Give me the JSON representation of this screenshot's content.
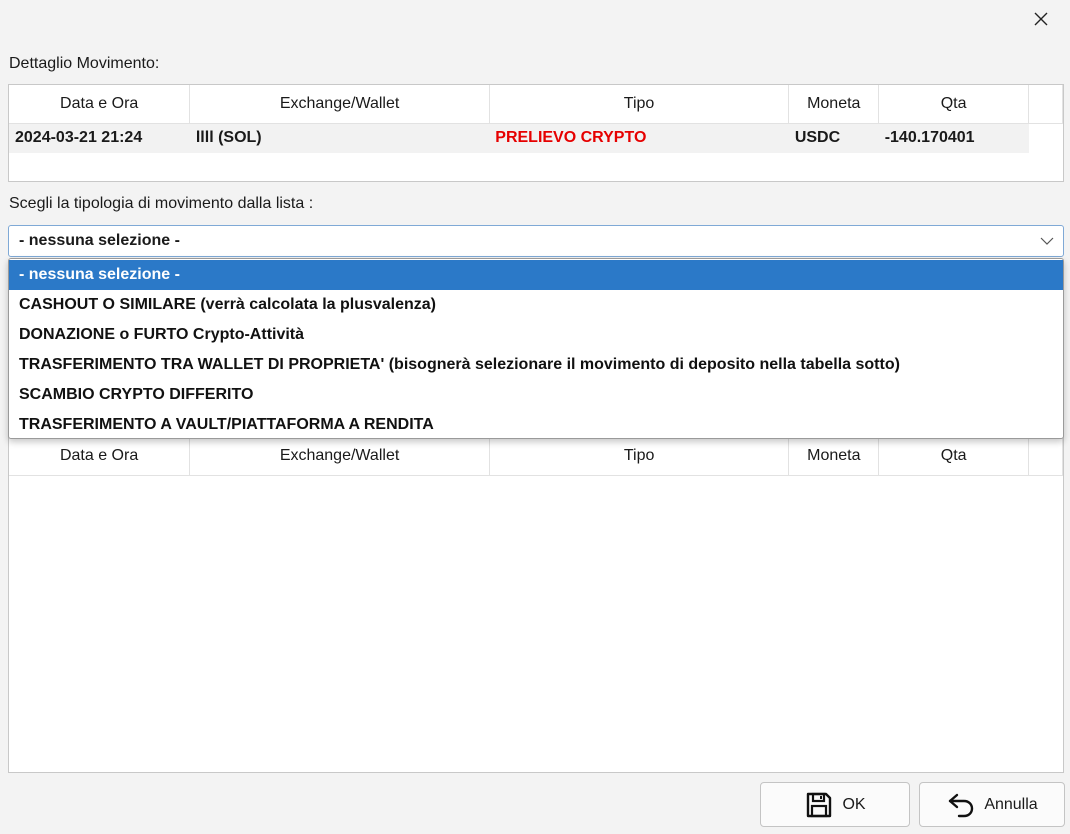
{
  "dialog": {
    "detail_label": "Dettaglio Movimento:",
    "choose_label": "Scegli la tipologia di movimento dalla lista :"
  },
  "columns": [
    "Data e Ora",
    "Exchange/Wallet",
    "Tipo",
    "Moneta",
    "Qta"
  ],
  "detail_row": {
    "date": "2024-03-21 21:24",
    "wallet": "llll (SOL)",
    "type": "PRELIEVO CRYPTO",
    "currency": "USDC",
    "qty": "-140.170401"
  },
  "combo": {
    "selected": "- nessuna selezione -"
  },
  "dropdown_options": [
    "- nessuna selezione -",
    "CASHOUT O SIMILARE (verrà calcolata la plusvalenza)",
    "DONAZIONE o FURTO Crypto-Attività",
    "TRASFERIMENTO TRA WALLET DI PROPRIETA' (bisognerà selezionare il movimento di deposito nella tabella sotto)",
    "SCAMBIO CRYPTO DIFFERITO",
    "TRASFERIMENTO A VAULT/PIATTAFORMA A RENDITA"
  ],
  "buttons": {
    "ok": "OK",
    "cancel": "Annulla"
  },
  "icons": {
    "close": "close-icon",
    "chevron": "chevron-down-icon",
    "save": "save-icon",
    "undo": "undo-arrow-icon"
  },
  "colors": {
    "accent": "#2b79c8",
    "type_red": "#e60000"
  }
}
